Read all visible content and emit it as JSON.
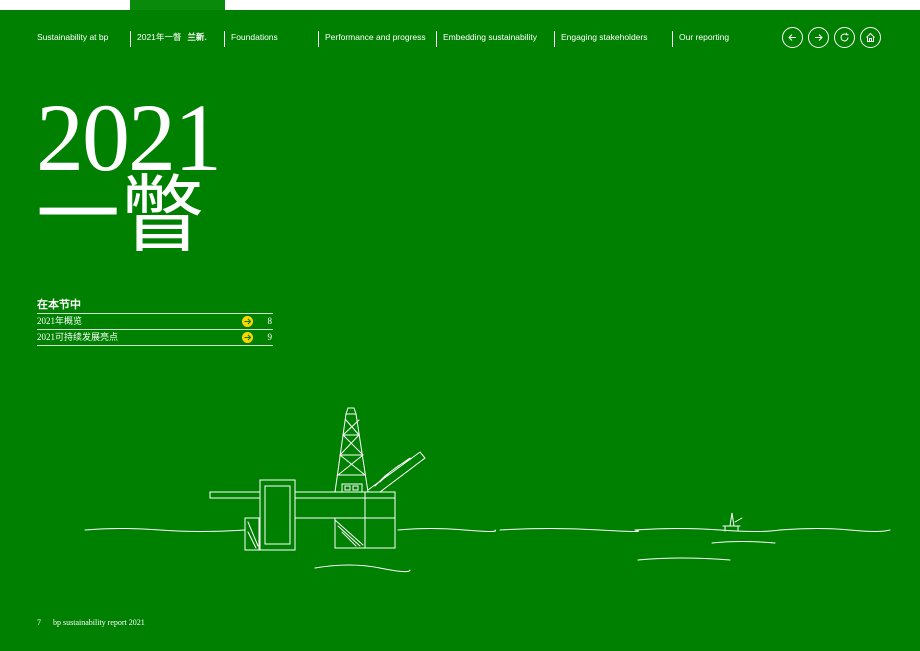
{
  "nav": {
    "items": [
      {
        "label": "Sustainability at bp"
      },
      {
        "label": "2021年一瞥",
        "bold": "兰新."
      },
      {
        "label": "Foundations"
      },
      {
        "label": "Performance and progress"
      },
      {
        "label": "Embedding sustainability"
      },
      {
        "label": "Engaging stakeholders"
      },
      {
        "label": "Our reporting"
      }
    ],
    "icons": [
      "back-arrow-icon",
      "forward-arrow-icon",
      "refresh-icon",
      "home-icon"
    ]
  },
  "hero": {
    "year": "2021",
    "subtitle": "一瞥"
  },
  "section": {
    "title": "在本节中",
    "items": [
      {
        "label": "2021年概览",
        "page": "8"
      },
      {
        "label": "2021可持续发展亮点",
        "page": "9"
      }
    ]
  },
  "footer": {
    "page": "7",
    "text": "bp sustainability report 2021"
  },
  "colors": {
    "background": "#008000",
    "accent": "#ffd400",
    "text": "#ffffff"
  }
}
